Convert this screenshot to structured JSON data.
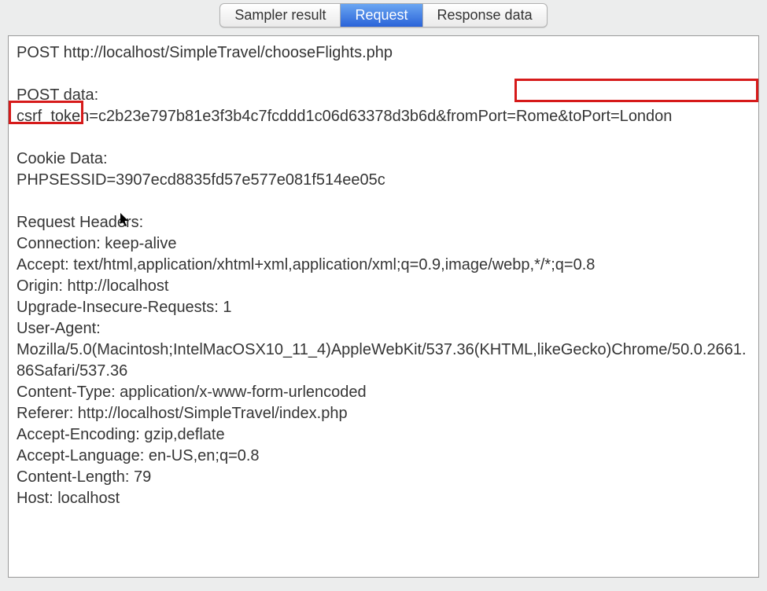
{
  "tabs": {
    "sampler_result": "Sampler result",
    "request": "Request",
    "response_data": "Response data"
  },
  "request": {
    "method_url": "POST http://localhost/SimpleTravel/chooseFlights.php",
    "post_data_label": "POST data:",
    "post_data_prefix": "csrf_token=c2b23e797b81e3f3b4c7fcddd1c06d63378d3b6d&",
    "post_data_highlight_part1": "fromPort=Rome&toPort=L",
    "post_data_highlight_part2": "ondon",
    "cookie_data_label": "Cookie Data:",
    "cookie_data_value": "PHPSESSID=3907ecd8835fd57e577e081f514ee05c",
    "headers_label": "Request Headers:",
    "headers": {
      "connection": "Connection: keep-alive",
      "accept": "Accept: text/html,application/xhtml+xml,application/xml;q=0.9,image/webp,*/*;q=0.8",
      "origin": "Origin: http://localhost",
      "upgrade": "Upgrade-Insecure-Requests: 1",
      "user_agent_label": "User-Agent:",
      "user_agent_value": "Mozilla/5.0(Macintosh;IntelMacOSX10_11_4)AppleWebKit/537.36(KHTML,likeGecko)Chrome/50.0.2661.86Safari/537.36",
      "content_type": "Content-Type: application/x-www-form-urlencoded",
      "referer": "Referer: http://localhost/SimpleTravel/index.php",
      "accept_encoding": "Accept-Encoding: gzip,deflate",
      "accept_language": "Accept-Language: en-US,en;q=0.8",
      "content_length": "Content-Length: 79",
      "host": "Host: localhost"
    }
  }
}
